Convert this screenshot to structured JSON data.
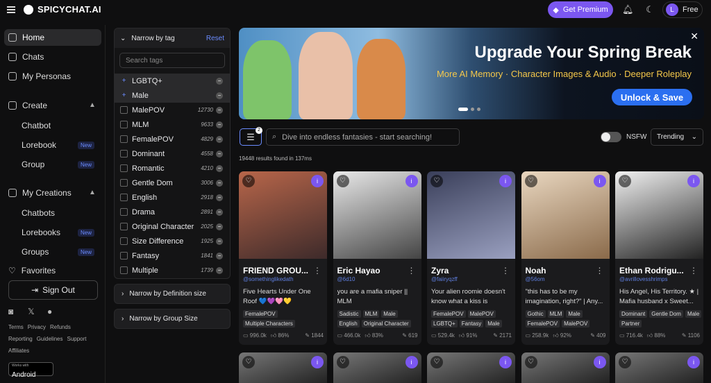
{
  "header": {
    "logo": "SPICYCHAT.AI",
    "premium": "Get Premium",
    "user_initial": "L",
    "plan": "Free"
  },
  "nav": {
    "home": "Home",
    "chats": "Chats",
    "personas": "My Personas",
    "create": "Create",
    "chatbot": "Chatbot",
    "lorebook": "Lorebook",
    "group": "Group",
    "new": "New",
    "creations": "My Creations",
    "chatbots": "Chatbots",
    "lorebooks": "Lorebooks",
    "groups": "Groups",
    "favorites": "Favorites",
    "signout": "Sign Out"
  },
  "footer": {
    "row1": [
      "Terms",
      "Privacy",
      "Refunds"
    ],
    "row2": [
      "Reporting",
      "Guidelines",
      "Support"
    ],
    "row3": [
      "Affiliates"
    ],
    "android_small": "Works with",
    "android": "Android"
  },
  "filter": {
    "title": "Narrow by tag",
    "reset": "Reset",
    "search_placeholder": "Search tags",
    "tags": [
      {
        "label": "LGBTQ+",
        "count": "",
        "selected": true
      },
      {
        "label": "Male",
        "count": "",
        "selected": true
      },
      {
        "label": "MalePOV",
        "count": "12730"
      },
      {
        "label": "MLM",
        "count": "9633"
      },
      {
        "label": "FemalePOV",
        "count": "4829"
      },
      {
        "label": "Dominant",
        "count": "4558"
      },
      {
        "label": "Romantic",
        "count": "4210"
      },
      {
        "label": "Gentle Dom",
        "count": "3006"
      },
      {
        "label": "English",
        "count": "2918"
      },
      {
        "label": "Drama",
        "count": "2891"
      },
      {
        "label": "Original Character",
        "count": "2025"
      },
      {
        "label": "Size Difference",
        "count": "1925"
      },
      {
        "label": "Fantasy",
        "count": "1841"
      },
      {
        "label": "Multiple",
        "count": "1739"
      }
    ],
    "def_size": "Narrow by Definition size",
    "group_size": "Narrow by Group Size"
  },
  "banner": {
    "title": "Upgrade Your Spring Break",
    "subtitle": "More AI Memory · Character Images & Audio · Deeper Roleplay",
    "cta": "Unlock & Save"
  },
  "search": {
    "badge": "2",
    "placeholder": "Dive into endless fantasies - start searching!",
    "nsfw": "NSFW",
    "sort": "Trending",
    "results": "19448 results found in 137ms"
  },
  "cards": [
    {
      "name": "FRIEND GROU...",
      "handle": "@somethinglikedath",
      "desc": "Five Hearts Under One Roof 💙💜🩷💛",
      "tags": [
        "FemalePOV",
        "Multiple Characters"
      ],
      "views": "996.0k",
      "like": "86%",
      "msgs": "1844",
      "colors": [
        "#b8664a",
        "#3d2a2a"
      ]
    },
    {
      "name": "Eric Hayao",
      "handle": "@6d10",
      "desc": "you are a mafia sniper || MLM",
      "tags": [
        "Sadistic",
        "MLM",
        "Male",
        "English",
        "Original Character"
      ],
      "views": "466.0k",
      "like": "83%",
      "msgs": "619",
      "colors": [
        "#e9e9e9",
        "#444"
      ]
    },
    {
      "name": "Zyra",
      "handle": "@faiiryqzff",
      "desc": "Your alien roomie doesn't know what a kiss is",
      "tags": [
        "FemalePOV",
        "MalePOV",
        "LGBTQ+",
        "Fantasy",
        "Male"
      ],
      "views": "529.4k",
      "like": "91%",
      "msgs": "2171",
      "colors": [
        "#3a3f5a",
        "#9aa0c0"
      ]
    },
    {
      "name": "Noah",
      "handle": "@56om",
      "desc": "\"this has to be my imagination, right?\" | Any...",
      "tags": [
        "Gothic",
        "MLM",
        "Male",
        "FemalePOV",
        "MalePOV"
      ],
      "views": "258.9k",
      "like": "92%",
      "msgs": "409",
      "colors": [
        "#e9d7c0",
        "#8a6a4a"
      ]
    },
    {
      "name": "Ethan Rodrigu...",
      "handle": "@avrillovesshrimps",
      "desc": "His Angel, His Territory. ★ | Mafia husband x Sweet...",
      "tags": [
        "Dominant",
        "Gentle Dom",
        "Male",
        "Partner"
      ],
      "views": "716.4k",
      "like": "88%",
      "msgs": "1106",
      "colors": [
        "#f1f1f1",
        "#222"
      ]
    }
  ]
}
